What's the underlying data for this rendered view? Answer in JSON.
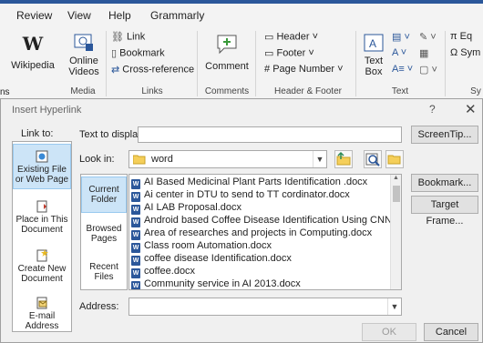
{
  "ribbon": {
    "tabs": [
      "Review",
      "View",
      "Help",
      "Grammarly"
    ],
    "groups": {
      "media": {
        "label": "Media",
        "wikipedia": "Wikipedia",
        "online_videos_1": "Online",
        "online_videos_2": "Videos"
      },
      "links": {
        "label": "Links",
        "link": "Link",
        "bookmark": "Bookmark",
        "cross_reference": "Cross-reference"
      },
      "comments": {
        "label": "Comments",
        "comment": "Comment"
      },
      "header_footer": {
        "label": "Header & Footer",
        "header": "Header",
        "footer": "Footer",
        "page_number": "Page Number"
      },
      "text": {
        "label": "Text",
        "text_box_1": "Text",
        "text_box_2": "Box"
      },
      "symbols": {
        "label": "Sy",
        "eq": "Eq",
        "sym": "Sym"
      }
    },
    "left_cut_label": "ns"
  },
  "dialog": {
    "title": "Insert Hyperlink",
    "help": "?",
    "close": "✕",
    "link_to_label": "Link to:",
    "link_to": [
      {
        "line1": "Existing File",
        "line2": "or Web Page"
      },
      {
        "line1": "Place in This",
        "line2": "Document"
      },
      {
        "line1": "Create New",
        "line2": "Document"
      },
      {
        "line1": "E-mail",
        "line2": "Address"
      }
    ],
    "text_to_display_label": "Text to display:",
    "text_to_display_value": "",
    "screentip_button": "ScreenTip...",
    "look_in_label": "Look in:",
    "look_in_value": "word",
    "sidebar": [
      {
        "line1": "Current",
        "line2": "Folder"
      },
      {
        "line1": "Browsed",
        "line2": "Pages"
      },
      {
        "line1": "Recent",
        "line2": "Files"
      }
    ],
    "files": [
      "AI Based Medicinal Plant Parts Identification .docx",
      "Ai center in DTU to send to TT cordinator.docx",
      "AI LAB Proposal.docx",
      "Android based Coffee Disease Identification Using CNN and H",
      "Area of researches and projects in Computing.docx",
      "Class room Automation.docx",
      "coffee disease Identification.docx",
      "coffee.docx",
      "Community service in AI 2013.docx"
    ],
    "bookmark_button": "Bookmark...",
    "target_frame_button": "Target Frame...",
    "address_label": "Address:",
    "address_value": "",
    "ok_button": "OK",
    "cancel_button": "Cancel"
  },
  "colors": {
    "accent": "#2b579a",
    "selection": "#cce4f7"
  }
}
